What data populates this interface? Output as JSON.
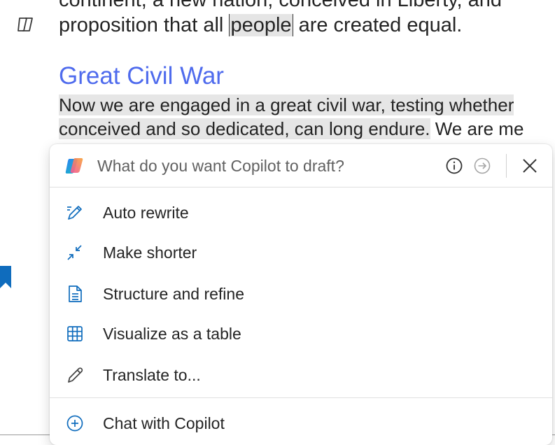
{
  "document": {
    "line_top": "continent, a new nation, conceived in Liberty, and",
    "line_prop_before": "proposition that all ",
    "line_prop_selected": "people",
    "line_prop_after": " are created equal.",
    "heading": "Great Civil War",
    "body_line1": "Now we are engaged in a great civil war, testing whether",
    "body_line2_highlight": "conceived and so dedicated, can long endure.",
    "body_line2_rest": " We are me"
  },
  "copilot": {
    "prompt_placeholder": "What do you want Copilot to draft?",
    "items": [
      {
        "label": "Auto rewrite",
        "icon": "pen-sparkle-icon"
      },
      {
        "label": "Make shorter",
        "icon": "arrows-collapse-icon"
      },
      {
        "label": "Structure and refine",
        "icon": "document-lines-icon"
      },
      {
        "label": "Visualize as a table",
        "icon": "table-icon"
      },
      {
        "label": "Translate to...",
        "icon": "pencil-icon"
      }
    ],
    "chat_item": {
      "label": "Chat with Copilot",
      "icon": "add-circle-icon"
    }
  },
  "colors": {
    "heading": "#4f6bed",
    "highlight": "#e6e6e6",
    "icon_blue": "#0f6cbd"
  }
}
